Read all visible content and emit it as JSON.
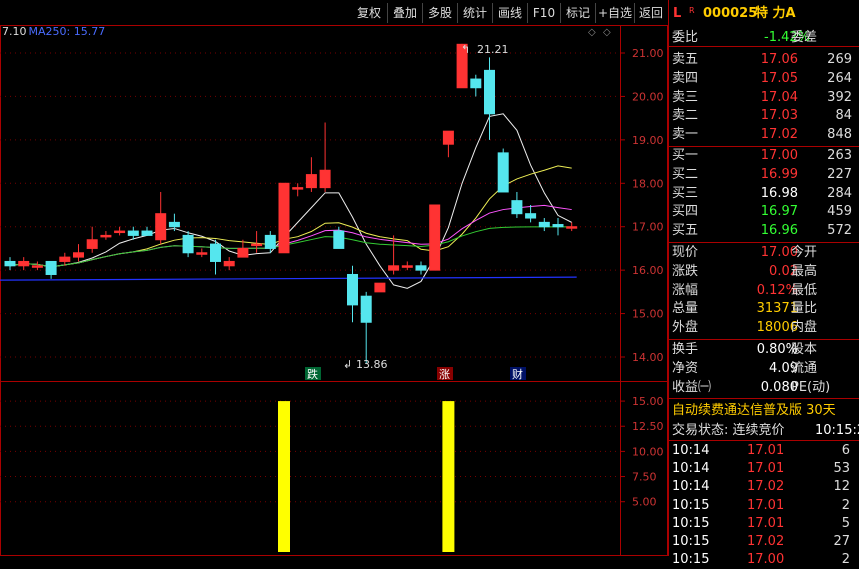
{
  "toolbar": {
    "buttons": [
      "复权",
      "叠加",
      "多股",
      "统计",
      "画线",
      "F10",
      "标记",
      "+自选",
      "返回"
    ]
  },
  "legend": {
    "prefix": "7.10",
    "ma": "MA250: 15.77"
  },
  "axis": {
    "price_ticks": [
      "21.00",
      "20.00",
      "19.00",
      "18.00",
      "17.00",
      "16.00",
      "15.00",
      "14.00"
    ],
    "vol_ticks": [
      "15.00",
      "12.50",
      "10.00",
      "7.50",
      "5.00"
    ]
  },
  "annotations": {
    "high": "21.21",
    "low": "13.86",
    "die": "跌",
    "zhang": "涨",
    "cai": "财"
  },
  "quote": {
    "L": "L",
    "R": "R",
    "code": "000025",
    "name": "特 力A",
    "weibi_label": "委比",
    "weibi_value": "-1.42%",
    "weicha_label": "委差",
    "asks": [
      {
        "label": "卖五",
        "price": "17.06",
        "vol": "269"
      },
      {
        "label": "卖四",
        "price": "17.05",
        "vol": "264"
      },
      {
        "label": "卖三",
        "price": "17.04",
        "vol": "392"
      },
      {
        "label": "卖二",
        "price": "17.03",
        "vol": "84"
      },
      {
        "label": "卖一",
        "price": "17.02",
        "vol": "848"
      }
    ],
    "bids": [
      {
        "label": "买一",
        "price": "17.00",
        "vol": "263"
      },
      {
        "label": "买二",
        "price": "16.99",
        "vol": "227"
      },
      {
        "label": "买三",
        "price": "16.98",
        "vol": "284"
      },
      {
        "label": "买四",
        "price": "16.97",
        "vol": "459"
      },
      {
        "label": "买五",
        "price": "16.96",
        "vol": "572"
      }
    ],
    "stats": [
      {
        "l": "现价",
        "v": "17.00",
        "r": "今开"
      },
      {
        "l": "涨跌",
        "v": "0.02",
        "r": "最高"
      },
      {
        "l": "涨幅",
        "v": "0.12%",
        "r": "最低"
      },
      {
        "l": "总量",
        "v": "31371",
        "r": "量比"
      },
      {
        "l": "外盘",
        "v": "18006",
        "r": "内盘"
      }
    ],
    "stats2": [
      {
        "l": "换手",
        "v": "0.80%",
        "r": "股本"
      },
      {
        "l": "净资",
        "v": "4.09",
        "r": "流通"
      },
      {
        "l": "收益㈠",
        "v": "0.080",
        "r": "PE(动)"
      }
    ],
    "banner": "自动续费通达信普及版 30天",
    "status_label": "交易状态: 连续竞价",
    "status_time": "10:15:2",
    "ticks": [
      {
        "t": "10:14",
        "p": "17.01",
        "v": "6"
      },
      {
        "t": "10:14",
        "p": "17.01",
        "v": "53"
      },
      {
        "t": "10:14",
        "p": "17.02",
        "v": "12"
      },
      {
        "t": "10:15",
        "p": "17.01",
        "v": "2"
      },
      {
        "t": "10:15",
        "p": "17.01",
        "v": "5"
      },
      {
        "t": "10:15",
        "p": "17.02",
        "v": "27"
      },
      {
        "t": "10:15",
        "p": "17.00",
        "v": "2"
      }
    ]
  },
  "chart_data": {
    "type": "candlestick",
    "ylim": [
      13.5,
      21.5
    ],
    "candles": [
      {
        "o": 16.2,
        "c": 16.1,
        "h": 16.3,
        "l": 16.0
      },
      {
        "o": 16.1,
        "c": 16.2,
        "h": 16.3,
        "l": 16.0
      },
      {
        "o": 16.1,
        "c": 16.1,
        "h": 16.2,
        "l": 16.0
      },
      {
        "o": 16.2,
        "c": 15.9,
        "h": 16.2,
        "l": 15.8
      },
      {
        "o": 16.2,
        "c": 16.3,
        "h": 16.4,
        "l": 16.1
      },
      {
        "o": 16.3,
        "c": 16.4,
        "h": 16.6,
        "l": 16.2
      },
      {
        "o": 16.5,
        "c": 16.7,
        "h": 17.0,
        "l": 16.4
      },
      {
        "o": 16.8,
        "c": 16.8,
        "h": 16.9,
        "l": 16.7
      },
      {
        "o": 16.9,
        "c": 16.9,
        "h": 17.0,
        "l": 16.8
      },
      {
        "o": 16.9,
        "c": 16.8,
        "h": 17.0,
        "l": 16.7
      },
      {
        "o": 16.9,
        "c": 16.8,
        "h": 17.0,
        "l": 16.8
      },
      {
        "o": 16.7,
        "c": 17.3,
        "h": 17.8,
        "l": 16.6
      },
      {
        "o": 17.1,
        "c": 17.0,
        "h": 17.3,
        "l": 16.9
      },
      {
        "o": 16.8,
        "c": 16.4,
        "h": 16.9,
        "l": 16.3
      },
      {
        "o": 16.4,
        "c": 16.4,
        "h": 16.5,
        "l": 16.3
      },
      {
        "o": 16.6,
        "c": 16.2,
        "h": 16.7,
        "l": 15.9
      },
      {
        "o": 16.1,
        "c": 16.2,
        "h": 16.3,
        "l": 16.0
      },
      {
        "o": 16.3,
        "c": 16.5,
        "h": 16.7,
        "l": 16.3
      },
      {
        "o": 16.6,
        "c": 16.6,
        "h": 16.9,
        "l": 16.4
      },
      {
        "o": 16.8,
        "c": 16.5,
        "h": 16.9,
        "l": 16.4
      },
      {
        "o": 16.4,
        "c": 18.0,
        "h": 18.0,
        "l": 16.4
      },
      {
        "o": 17.9,
        "c": 17.9,
        "h": 18.0,
        "l": 17.7
      },
      {
        "o": 17.9,
        "c": 18.2,
        "h": 18.6,
        "l": 17.8
      },
      {
        "o": 17.9,
        "c": 18.3,
        "h": 19.4,
        "l": 17.8
      },
      {
        "o": 16.9,
        "c": 16.5,
        "h": 17.0,
        "l": 16.5
      },
      {
        "o": 15.9,
        "c": 15.2,
        "h": 16.1,
        "l": 14.8
      },
      {
        "o": 15.4,
        "c": 14.8,
        "h": 15.5,
        "l": 13.86
      },
      {
        "o": 15.5,
        "c": 15.7,
        "h": 15.7,
        "l": 15.5
      },
      {
        "o": 16.0,
        "c": 16.1,
        "h": 16.8,
        "l": 15.9
      },
      {
        "o": 16.1,
        "c": 16.1,
        "h": 16.2,
        "l": 16.0
      },
      {
        "o": 16.1,
        "c": 16.0,
        "h": 16.2,
        "l": 15.9
      },
      {
        "o": 16.0,
        "c": 17.5,
        "h": 17.5,
        "l": 16.0
      },
      {
        "o": 18.9,
        "c": 19.2,
        "h": 19.2,
        "l": 18.6
      },
      {
        "o": 20.2,
        "c": 21.2,
        "h": 21.21,
        "l": 20.2
      },
      {
        "o": 20.4,
        "c": 20.2,
        "h": 20.5,
        "l": 20.0
      },
      {
        "o": 20.6,
        "c": 19.6,
        "h": 20.9,
        "l": 19.0
      },
      {
        "o": 18.7,
        "c": 17.8,
        "h": 18.8,
        "l": 17.8
      },
      {
        "o": 17.6,
        "c": 17.3,
        "h": 17.8,
        "l": 17.2
      },
      {
        "o": 17.3,
        "c": 17.2,
        "h": 17.5,
        "l": 17.1
      },
      {
        "o": 17.1,
        "c": 17.0,
        "h": 17.2,
        "l": 16.9
      },
      {
        "o": 17.05,
        "c": 17.0,
        "h": 17.2,
        "l": 16.8
      },
      {
        "o": 17.0,
        "c": 17.0,
        "h": 17.1,
        "l": 16.9
      }
    ],
    "ma250": [
      15.77,
      15.77
    ],
    "volume_ylim": [
      0,
      16.5
    ],
    "volume_bars": [
      {
        "index": 20,
        "value": 15.0
      },
      {
        "index": 32,
        "value": 15.0
      }
    ]
  }
}
